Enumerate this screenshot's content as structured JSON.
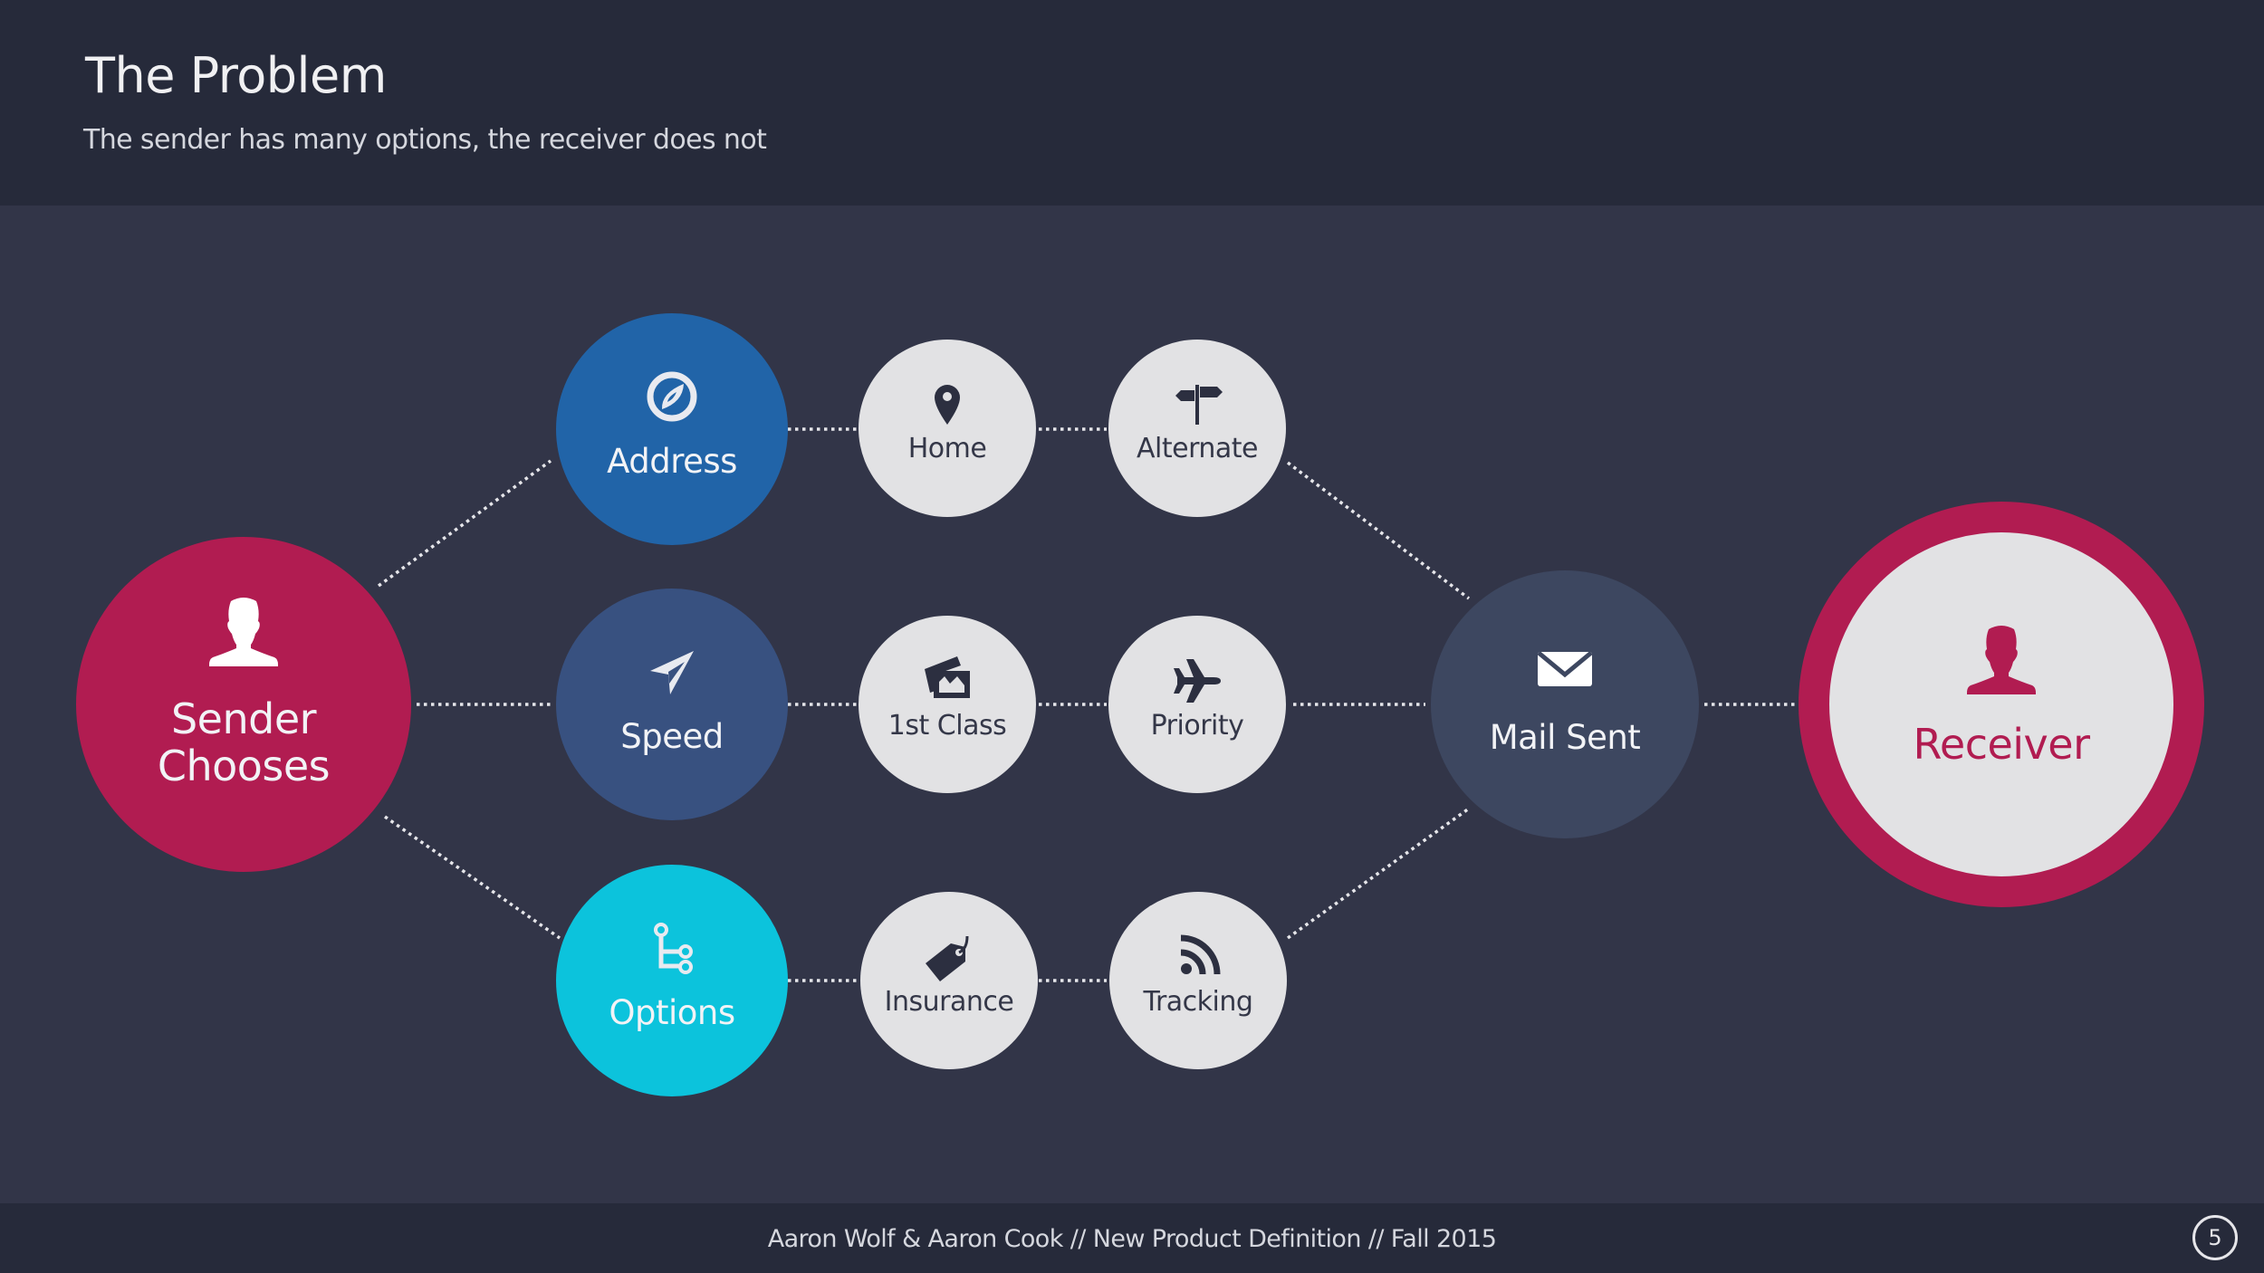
{
  "header": {
    "title": "The Problem",
    "subtitle": "The sender has many options, the receiver does not"
  },
  "colors": {
    "header_bg": "#262a3a",
    "body_bg": "#323548",
    "sender": "#b11c51",
    "address": "#2164a8",
    "speed": "#385180",
    "options": "#0cc3dc",
    "option_node": "#e2e2e4",
    "mail_sent": "#3d4760",
    "receiver_ring": "#b11c51",
    "receiver_fill": "#e2e2e4",
    "icon_dark": "#2c2f40",
    "connector": "#e6e6ea"
  },
  "diagram": {
    "sender": {
      "label_line1": "Sender",
      "label_line2": "Chooses",
      "icon": "person-icon"
    },
    "categories": [
      {
        "id": "address",
        "label": "Address",
        "icon": "compass-icon",
        "options": [
          {
            "label": "Home",
            "icon": "map-pin-icon"
          },
          {
            "label": "Alternate",
            "icon": "signpost-icon"
          }
        ]
      },
      {
        "id": "speed",
        "label": "Speed",
        "icon": "navigation-arrow-icon",
        "options": [
          {
            "label": "1st Class",
            "icon": "pictures-icon"
          },
          {
            "label": "Priority",
            "icon": "airplane-icon"
          }
        ]
      },
      {
        "id": "options",
        "label": "Options",
        "icon": "branch-icon",
        "options": [
          {
            "label": "Insurance",
            "icon": "tag-icon"
          },
          {
            "label": "Tracking",
            "icon": "rss-feed-icon"
          }
        ]
      }
    ],
    "mail_sent": {
      "label": "Mail Sent",
      "icon": "envelope-icon"
    },
    "receiver": {
      "label": "Receiver",
      "icon": "person-icon"
    }
  },
  "footer": {
    "text": "Aaron Wolf & Aaron Cook // New Product Definition // Fall 2015",
    "page_number": "5"
  }
}
